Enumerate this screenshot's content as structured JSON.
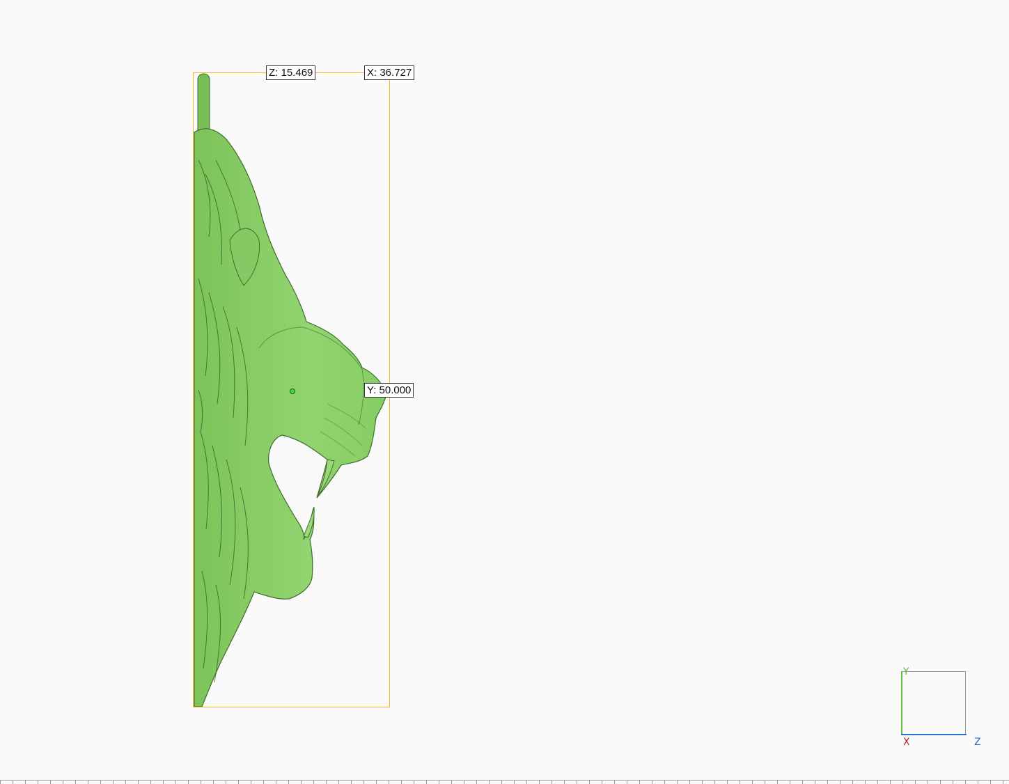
{
  "viewport": {
    "background": "#fafafa",
    "model_color": "#8ccf6a",
    "bbox_color": "#f3b61f"
  },
  "dimensions": {
    "z_label": "Z: 15.469",
    "x_label": "X: 36.727",
    "y_label": "Y: 50.000"
  },
  "axis_gizmo": {
    "y": "Y",
    "x": "X",
    "z": "Z",
    "y_color": "#5fbf3a",
    "x_color": "#b02020",
    "z_color": "#2b6fd0"
  }
}
